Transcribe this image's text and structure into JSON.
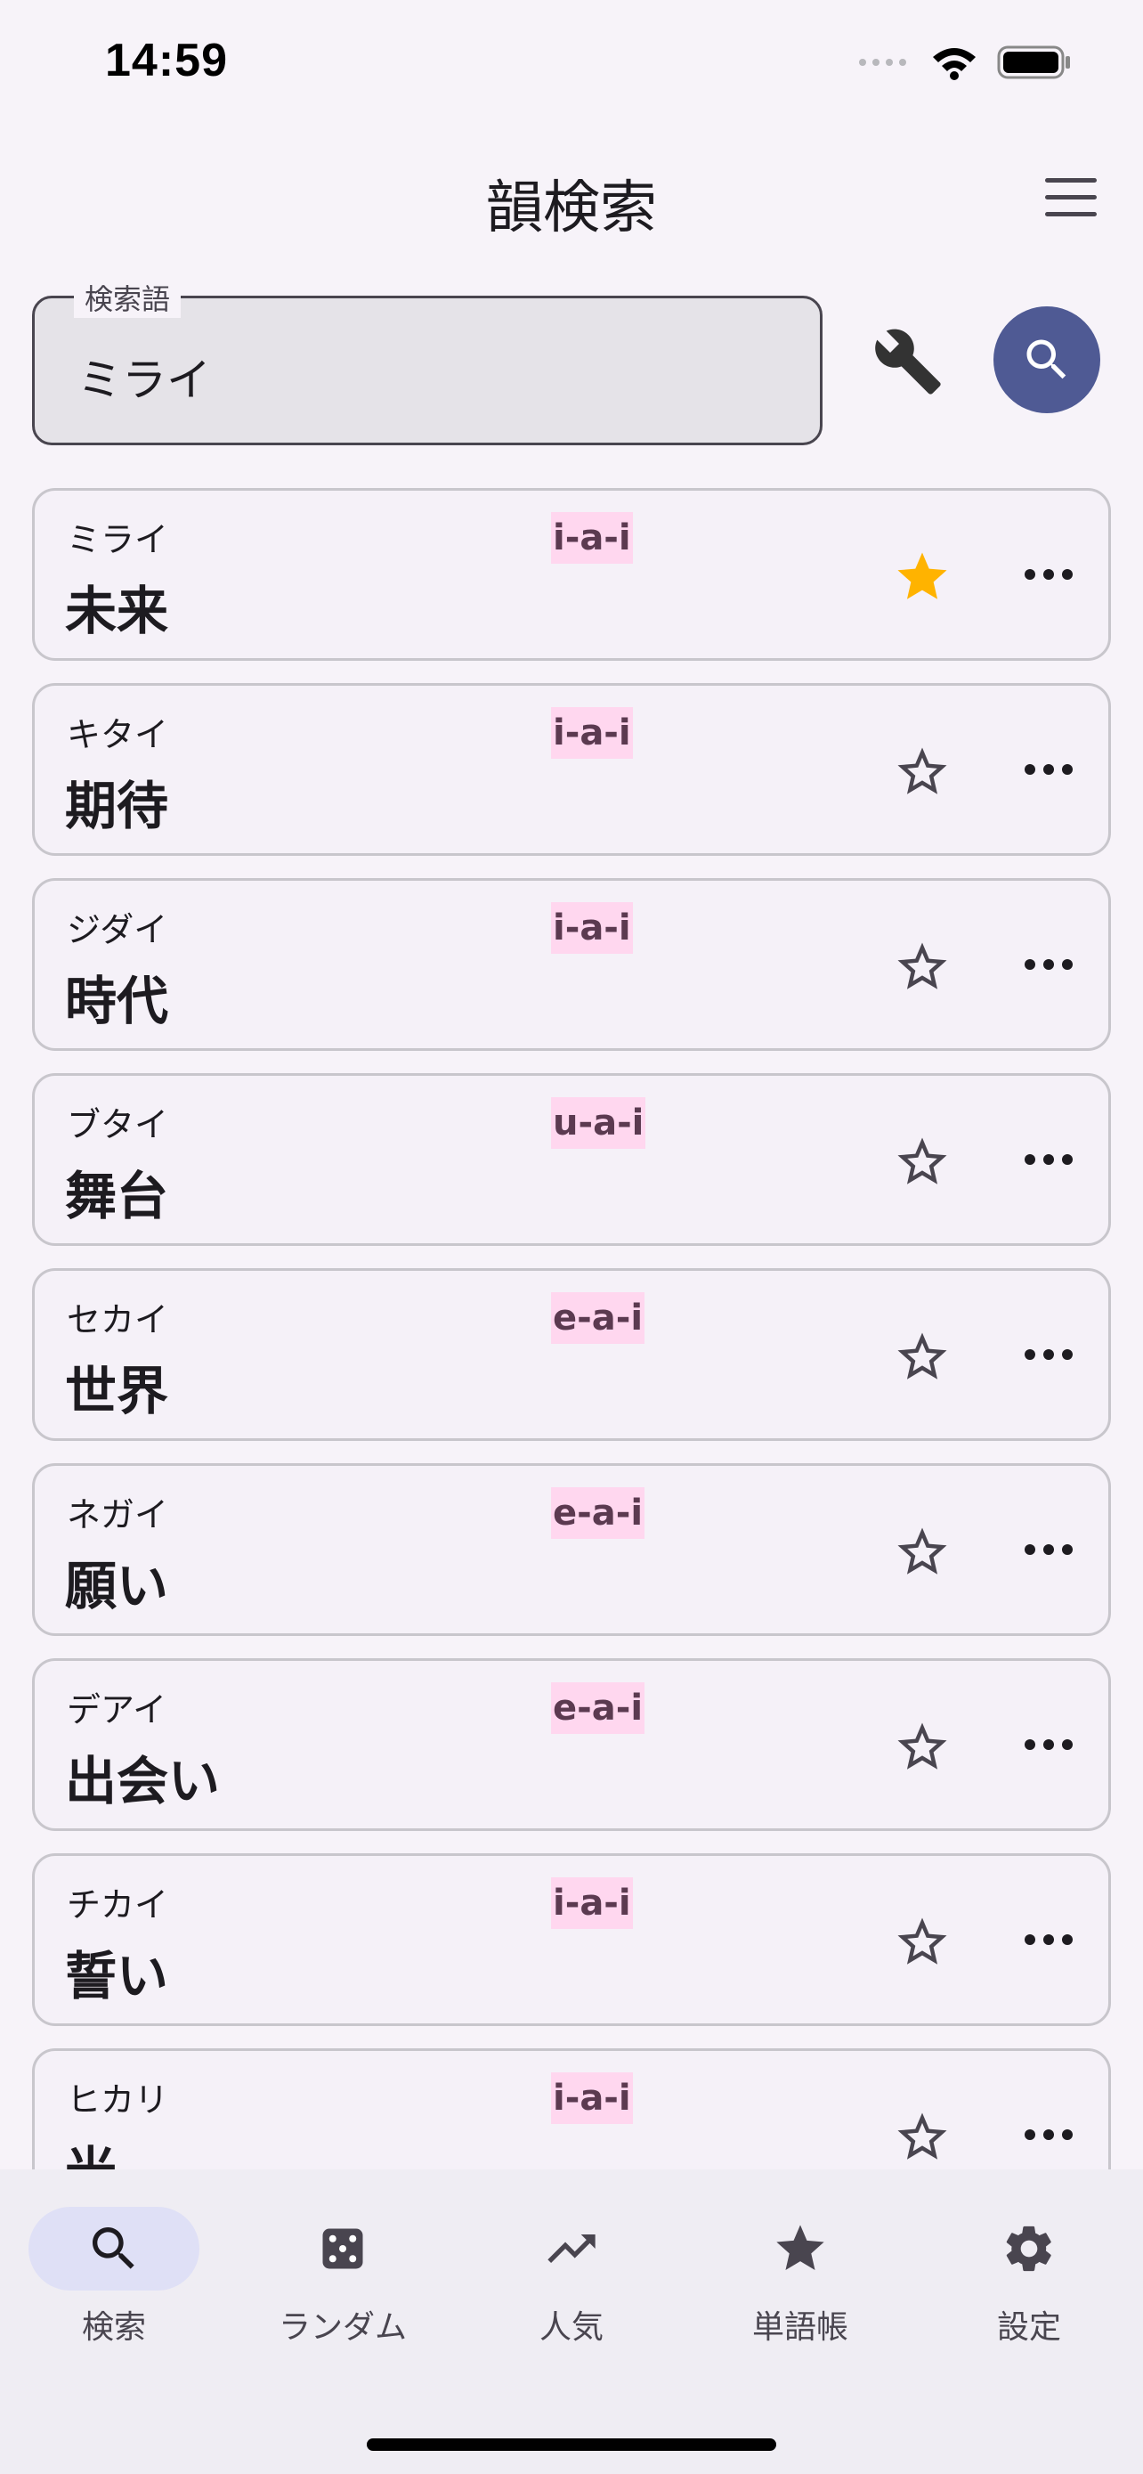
{
  "status_bar": {
    "time": "14:59"
  },
  "app": {
    "title": "韻検索"
  },
  "search": {
    "label": "検索語",
    "value": "ミライ"
  },
  "results": [
    {
      "reading": "ミライ",
      "word": "未来",
      "vowels": "i-a-i",
      "favorite": true
    },
    {
      "reading": "キタイ",
      "word": "期待",
      "vowels": "i-a-i",
      "favorite": false
    },
    {
      "reading": "ジダイ",
      "word": "時代",
      "vowels": "i-a-i",
      "favorite": false
    },
    {
      "reading": "ブタイ",
      "word": "舞台",
      "vowels": "u-a-i",
      "favorite": false
    },
    {
      "reading": "セカイ",
      "word": "世界",
      "vowels": "e-a-i",
      "favorite": false
    },
    {
      "reading": "ネガイ",
      "word": "願い",
      "vowels": "e-a-i",
      "favorite": false
    },
    {
      "reading": "デアイ",
      "word": "出会い",
      "vowels": "e-a-i",
      "favorite": false
    },
    {
      "reading": "チカイ",
      "word": "誓い",
      "vowels": "i-a-i",
      "favorite": false
    },
    {
      "reading": "ヒカリ",
      "word": "光",
      "vowels": "i-a-i",
      "favorite": false
    }
  ],
  "nav": {
    "items": [
      {
        "label": "検索",
        "icon": "search-icon",
        "active": true
      },
      {
        "label": "ランダム",
        "icon": "dice-icon",
        "active": false
      },
      {
        "label": "人気",
        "icon": "trending-up-icon",
        "active": false
      },
      {
        "label": "単語帳",
        "icon": "star-icon",
        "active": false
      },
      {
        "label": "設定",
        "icon": "gear-icon",
        "active": false
      }
    ]
  },
  "colors": {
    "accent": "#4f5a94",
    "favorite_star": "#ffb300",
    "vowel_highlight": "#ffd7ef",
    "nav_active": "#dfe0f6"
  }
}
